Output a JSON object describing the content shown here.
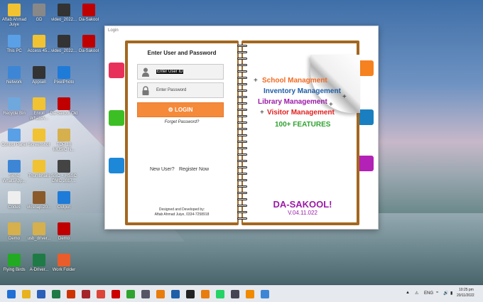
{
  "desktop": {
    "icons": [
      {
        "label": "Aftab Ahmad Juiye",
        "color": "#f1c232"
      },
      {
        "label": "GD",
        "color": "#888"
      },
      {
        "label": "video_2022...",
        "color": "#333"
      },
      {
        "label": "Da-Sakool",
        "color": "#c00000"
      },
      {
        "label": "This PC",
        "color": "#5aa0e6"
      },
      {
        "label": "Access 45...",
        "color": "#f1c232"
      },
      {
        "label": "video_2022...",
        "color": "#333"
      },
      {
        "label": "Da-Sakool",
        "color": "#c00000"
      },
      {
        "label": "Network",
        "color": "#3d86d6"
      },
      {
        "label": "Appsell",
        "color": "#333"
      },
      {
        "label": "PixelPhoto",
        "color": "#1f7bd8"
      },
      {
        "label": "Recycle Bin",
        "color": "#6fa8dc"
      },
      {
        "label": "Enroll WhatsA...",
        "color": "#f1c232"
      },
      {
        "label": "Da-Sakool Old",
        "color": "#c00000"
      },
      {
        "label": "Control Panel",
        "color": "#5aa0e6"
      },
      {
        "label": "Screenshot",
        "color": "#f1c232"
      },
      {
        "label": "TOP 10 MUSIC N...",
        "color": "#d6b04c"
      },
      {
        "label": "Send WhatsApp...",
        "color": "#3d86d6"
      },
      {
        "label": "Thumbnails",
        "color": "#f1c232"
      },
      {
        "label": "SSC + HSSC DMC 2017...",
        "color": "#444"
      },
      {
        "label": "Codes",
        "color": "#eee"
      },
      {
        "label": "vlcsnap-20...",
        "color": "#8a5a2b"
      },
      {
        "label": "Output",
        "color": "#1f7bd8"
      },
      {
        "label": "Demo",
        "color": "#d6b04c"
      },
      {
        "label": "usb_driver...",
        "color": "#d6b04c"
      },
      {
        "label": "Demo",
        "color": "#c00000"
      },
      {
        "label": "Flying Birds",
        "color": "#22aa22"
      },
      {
        "label": "A-Driver...",
        "color": "#1e7b45"
      },
      {
        "label": "Work Folder",
        "color": "#e85d2b"
      }
    ]
  },
  "window": {
    "title": "Login"
  },
  "login": {
    "heading": "Enter User and Password",
    "user_value": "Enter User ID",
    "password_value": "Enter Password",
    "login_label": "LOGIN",
    "forgot_label": "Forget Password?",
    "new_user_label": "New User?",
    "register_label": "Register Now",
    "credit_line1": "Designed and Developed by:",
    "credit_line2": "Aftab Ahmad Juiye, 0334-7258918"
  },
  "features": [
    {
      "text": "School Managment",
      "color": "#f26a21"
    },
    {
      "text": "Inventory Management",
      "color": "#1f5fa8"
    },
    {
      "text": "Library Management",
      "color": "#9b1aa8"
    },
    {
      "text": "Visitor Management",
      "color": "#e02020"
    },
    {
      "text": "100+ FEATURES",
      "color": "#2fa32f"
    }
  ],
  "brand": {
    "name": "DA-SAKOOL!",
    "version": "V.04.11.022"
  },
  "tab_colors": {
    "red": "#e8315a",
    "green": "#3cbf24",
    "blue": "#1e88d8",
    "orange": "#f6811f",
    "teal": "#1a7fc0",
    "purple": "#b321b6"
  },
  "taskbar": {
    "icons": [
      "windows-icon",
      "file-explorer-icon",
      "word-icon",
      "excel-icon",
      "illustrator-icon",
      "access-icon",
      "chrome-icon",
      "adobe-icon",
      "android-icon",
      "app-icon",
      "blender-icon",
      "photoshop-icon",
      "cinema-icon",
      "blender2-icon",
      "whatsapp-icon",
      "network-icon",
      "vlc-icon",
      "dasakool-icon"
    ],
    "lang": "ENG",
    "time": "10:25 pm",
    "date": "20/11/2022"
  }
}
